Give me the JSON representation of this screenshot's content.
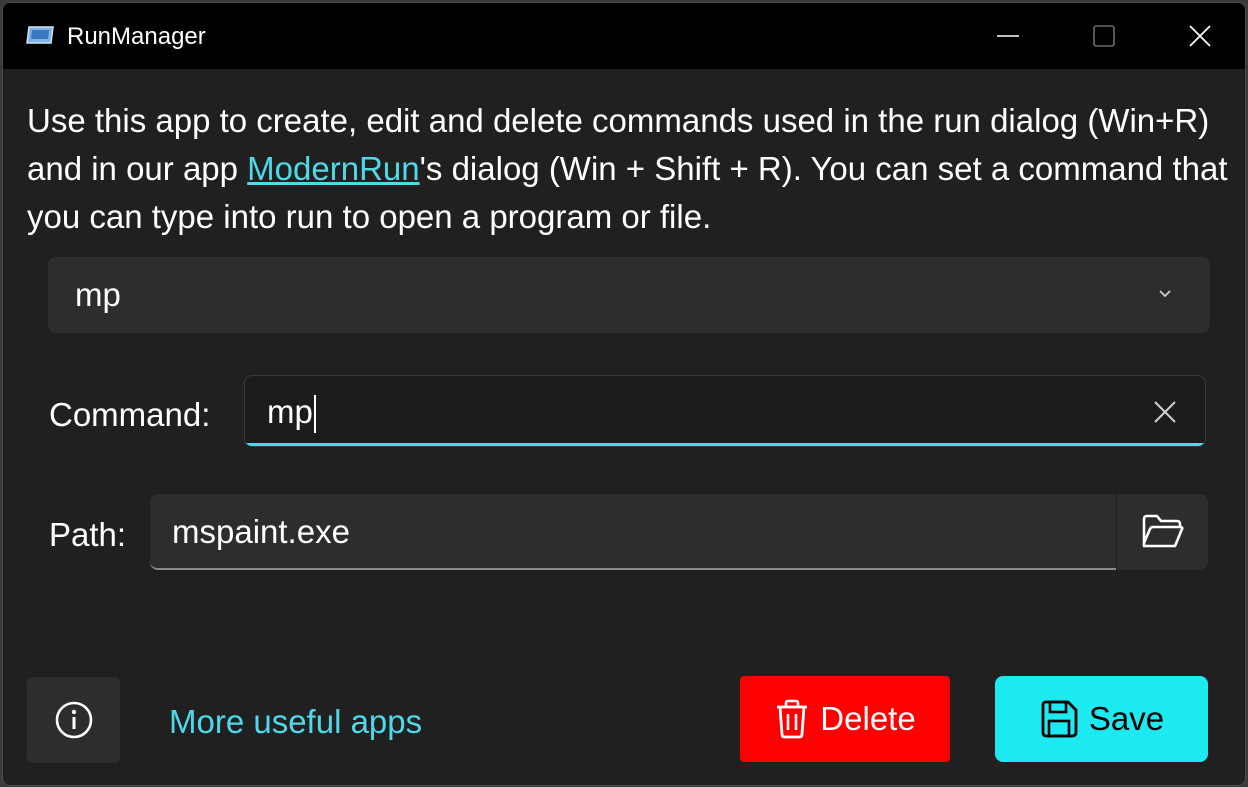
{
  "window": {
    "title": "RunManager",
    "icon": "run-app-icon"
  },
  "description": {
    "before_link": "Use this app to create, edit and delete commands used in the run dialog (Win+R) and in our app ",
    "link_text": "ModernRun",
    "after_link": "'s dialog (Win + Shift + R). You can set a command that you can type into run to open a program or file."
  },
  "command_selector": {
    "selected_value": "mp",
    "icon": "chevron-down-icon"
  },
  "command_field": {
    "label": "Command:",
    "value": "mp",
    "clear_icon": "close-icon"
  },
  "path_field": {
    "label": "Path:",
    "value": "mspaint.exe",
    "browse_icon": "folder-open-icon"
  },
  "footer": {
    "info_icon": "info-icon",
    "more_apps_link": "More useful apps",
    "delete_label": "Delete",
    "delete_icon": "trash-icon",
    "save_label": "Save",
    "save_icon": "save-icon"
  },
  "colors": {
    "accent": "#4fd8e8",
    "save_button": "#1de9f0",
    "delete_button": "#ff0000",
    "background": "#202020",
    "titlebar": "#000000"
  }
}
